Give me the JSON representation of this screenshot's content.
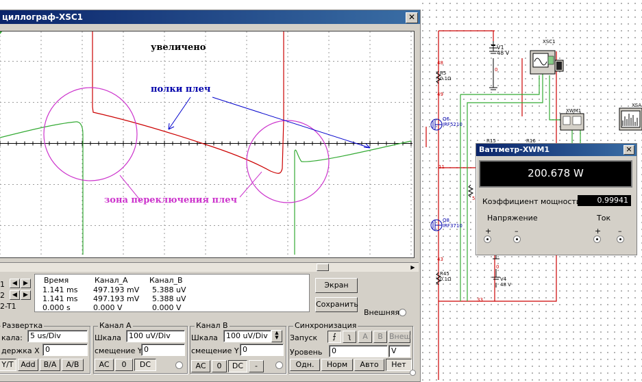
{
  "oscilloscope": {
    "title": "циллограф-XSC1",
    "annotations": {
      "zoomed": "увеличено",
      "arm_shelves": "полки плеч",
      "switch_zone": "зона переключения плеч"
    },
    "readouts": {
      "headers": [
        "Время",
        "Канал_A",
        "Канал_B"
      ],
      "rows": [
        {
          "label": "1",
          "time": "1.141 ms",
          "a": "497.193 mV",
          "b": "5.388 uV"
        },
        {
          "label": "2",
          "time": "1.141 ms",
          "a": "497.193 mV",
          "b": "5.388 uV"
        },
        {
          "label": "2-T1",
          "time": "0.000 s",
          "a": "0.000 V",
          "b": "0.000 V"
        }
      ]
    },
    "buttons": {
      "screen": "Экран",
      "save": "Сохранить",
      "external": "Внешняя"
    },
    "timebase": {
      "title": "Развертка",
      "scale_label": "кала:",
      "scale_value": "5 us/Div",
      "delay_label": "держка X",
      "delay_value": "0",
      "modes": [
        "Y/T",
        "Add",
        "B/A",
        "A/B"
      ]
    },
    "channel_a": {
      "title": "Канал А",
      "scale_label": "Шкала",
      "scale_value": "100 uV/Div",
      "offset_label": "смещение Y",
      "offset_value": "0",
      "modes": [
        "AC",
        "0",
        "DC"
      ]
    },
    "channel_b": {
      "title": "Канал В",
      "scale_label": "Шкала",
      "scale_value": "100 uV/Div",
      "offset_label": "смещение Y",
      "offset_value": "0",
      "modes": [
        "AC",
        "0",
        "DC",
        "-"
      ]
    },
    "trigger": {
      "title": "Синхронизация",
      "edge_label": "Запуск",
      "edge_buttons": [
        "A",
        "B",
        "Внеш"
      ],
      "level_label": "Уровень",
      "level_value": "0",
      "level_unit": "V",
      "modes": [
        "Одн.",
        "Норм",
        "Авто",
        "Нет"
      ]
    }
  },
  "wattmeter": {
    "title": "Ваттметр-XWM1",
    "reading": "200.678 W",
    "pf_label": "Коэффициент мощности:",
    "pf_value": "0.99941",
    "voltage_label": "Напряжение",
    "current_label": "Ток",
    "plus": "+",
    "minus": "–"
  },
  "schematic": {
    "v1": {
      "name": "V1",
      "value": "48 V"
    },
    "v4": {
      "name": "V4",
      "value": "48 V"
    },
    "r5": {
      "name": "R5",
      "value": "0.1Ω"
    },
    "r45": {
      "name": "R45",
      "value": "0.1Ω"
    },
    "q6": {
      "name": "Q6",
      "part": "IRF5210"
    },
    "q8": {
      "name": "Q8",
      "part": "IRF3710"
    },
    "r15": "R15",
    "r16": "R16",
    "xsc1": "XSC1",
    "xwm1": "XWM1",
    "xsa": "XSA",
    "nodes": [
      "48",
      "49",
      "0",
      "11",
      "43",
      "33",
      "0",
      "5"
    ]
  }
}
